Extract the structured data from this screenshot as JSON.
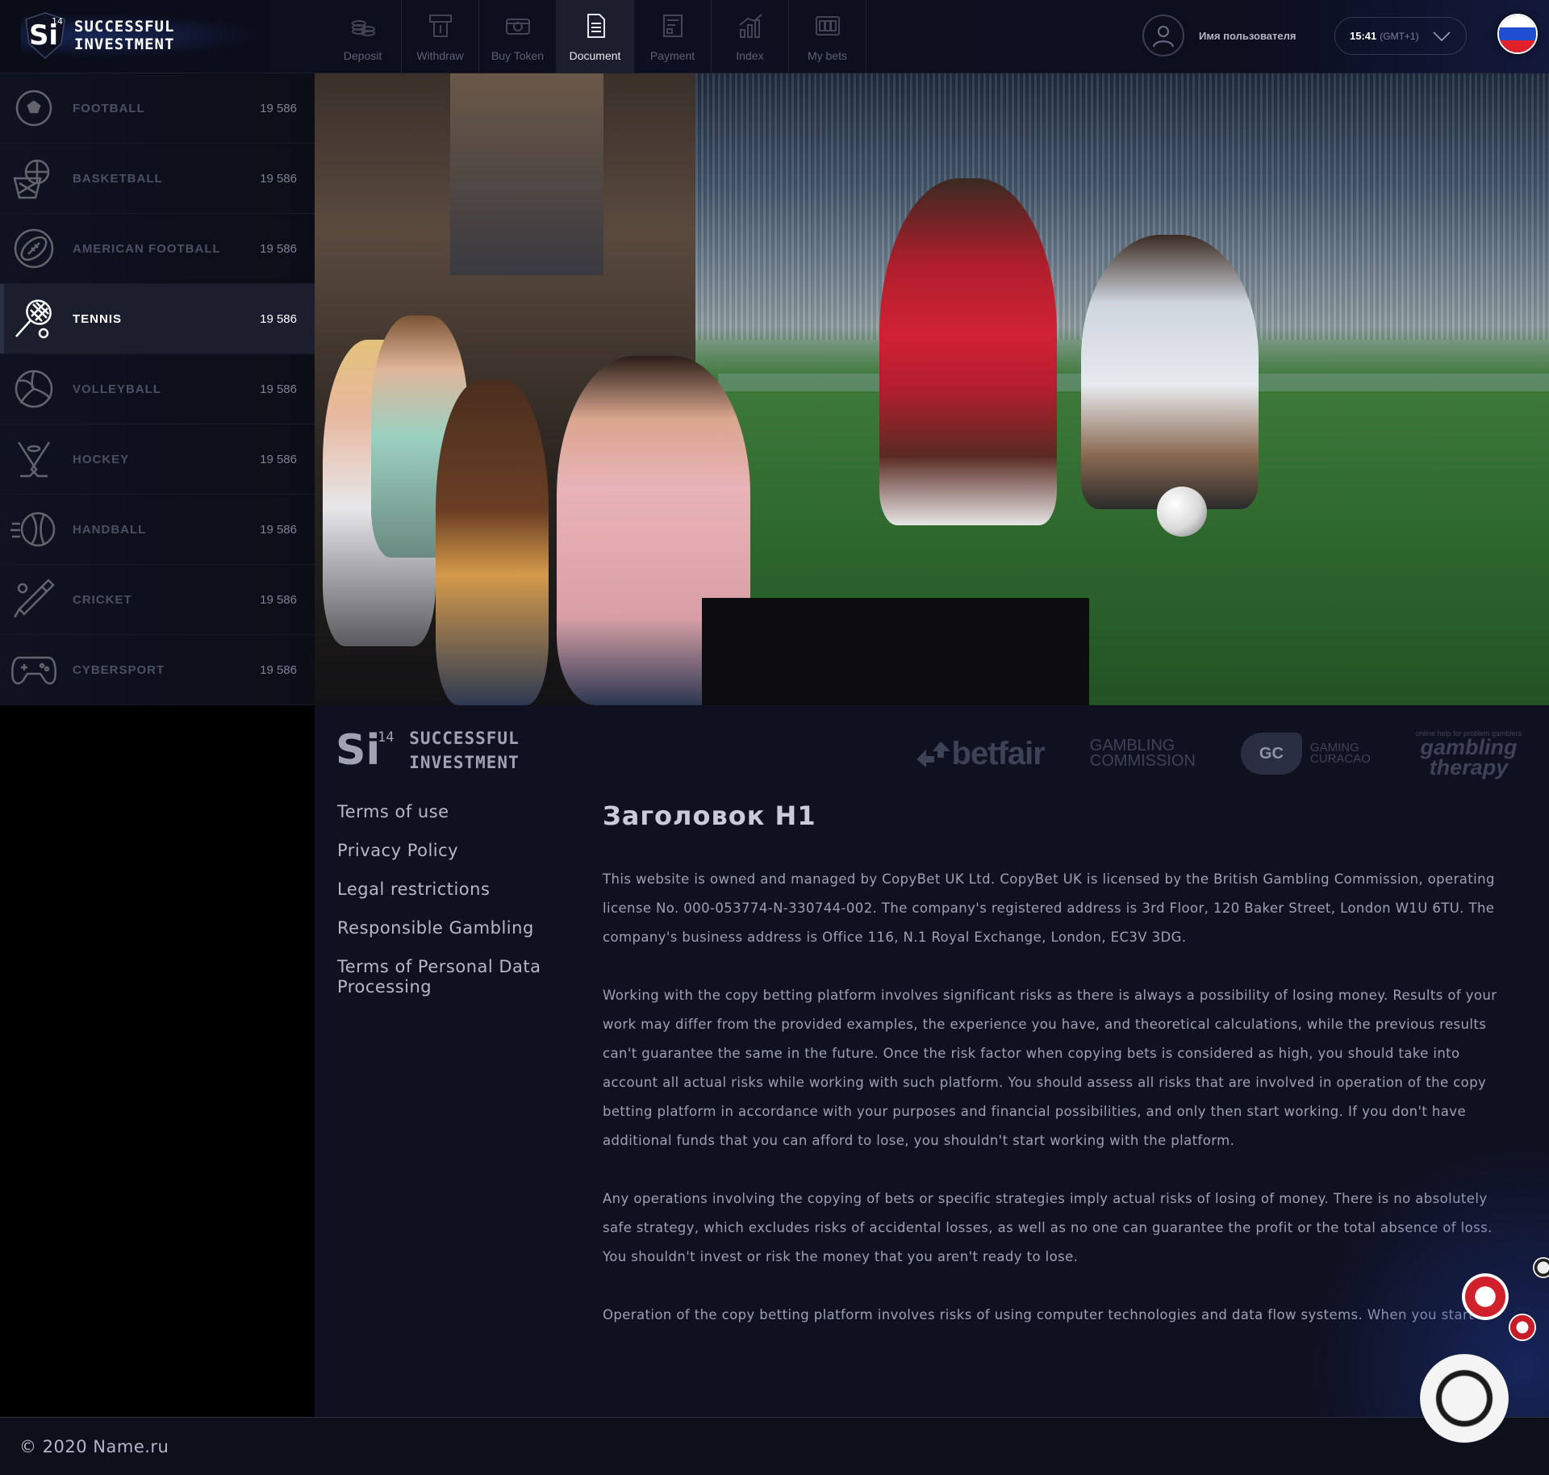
{
  "header": {
    "logo_num": "14",
    "logo_text": "SUCCESSFUL INVESTMENT",
    "nav": [
      {
        "label": "Deposit",
        "icon": "coins-icon"
      },
      {
        "label": "Withdraw",
        "icon": "withdraw-icon"
      },
      {
        "label": "Buy Token",
        "icon": "token-icon"
      },
      {
        "label": "Document",
        "icon": "document-icon"
      },
      {
        "label": "Payment",
        "icon": "payment-icon"
      },
      {
        "label": "Index",
        "icon": "chart-icon"
      },
      {
        "label": "My bets",
        "icon": "slot-icon"
      }
    ],
    "active_nav": "Document",
    "user_name": "Имя пользователя",
    "time": "15:41",
    "timezone": "(GMT+1)",
    "flag_colors": [
      "#ffffff",
      "#1f4fd0",
      "#e0212c"
    ]
  },
  "sidebar": {
    "items": [
      {
        "label": "FOOTBALL",
        "count": "19 586",
        "icon": "soccer-ball-icon"
      },
      {
        "label": "BASKETBALL",
        "count": "19 586",
        "icon": "basketball-icon"
      },
      {
        "label": "AMERICAN FOOTBALL",
        "count": "19 586",
        "icon": "american-football-icon"
      },
      {
        "label": "TENNIS",
        "count": "19 586",
        "icon": "tennis-racket-icon",
        "active": true
      },
      {
        "label": "VOLLEYBALL",
        "count": "19 586",
        "icon": "volleyball-icon"
      },
      {
        "label": "HOCKEY",
        "count": "19 586",
        "icon": "hockey-icon"
      },
      {
        "label": "HANDBALL",
        "count": "19 586",
        "icon": "handball-icon"
      },
      {
        "label": "CRICKET",
        "count": "19 586",
        "icon": "cricket-icon"
      },
      {
        "label": "CYBERSPORT",
        "count": "19 586",
        "icon": "gamepad-icon"
      }
    ]
  },
  "content": {
    "logo_num": "14",
    "logo_line1": "SUCCESSFUL",
    "logo_line2": "INVESTMENT",
    "partners": {
      "betfair": "betfair",
      "gambling_commission_1": "GAMBLING",
      "gambling_commission_2": "COMMISSION",
      "gc_badge": "GC",
      "gc_1": "GAMING",
      "gc_2": "CURACAO",
      "therapy_small": "online help for problem gamblers",
      "therapy_1": "gambling",
      "therapy_2": "therapy"
    },
    "links": [
      "Terms of use",
      "Privacy Policy",
      "Legal restrictions",
      "Responsible Gambling",
      "Terms of Personal Data Processing"
    ],
    "heading": "Заголовок H1",
    "paragraphs": [
      "This website is owned and managed by CopyBet UK Ltd. CopyBet UK is licensed by the British Gambling Commission, operating license No. 000-053774-N-330744-002. The company's registered address is 3rd Floor, 120 Baker Street, London W1U 6TU. The company's business address is Office 116, N.1 Royal Exchange, London, EC3V 3DG.",
      "Working with the copy betting platform involves significant risks as there is always a possibility of losing money. Results of your work may differ from the provided examples, the experience you have, and theoretical calculations, while the previous results can't guarantee the same in the future. Once the risk factor when copying bets is considered as high, you should take into account all actual risks while working with such platform. You should assess all risks that are involved in operation of the copy betting platform in accordance with your purposes and financial possibilities, and only then start working. If you don't have additional funds that you can afford to lose, you shouldn't start working with the platform.",
      "Any operations involving the copying of bets or specific strategies imply actual risks of losing of money. There is no absolutely safe strategy, which excludes risks of accidental losses, as well as no one can guarantee the profit or the total absence of loss. You shouldn't invest or risk the money that you aren't ready to lose.",
      "Operation of the copy betting platform involves risks of using computer technologies and data flow systems. When you start"
    ]
  },
  "footer": {
    "copyright": "© 2020 Name.ru"
  }
}
